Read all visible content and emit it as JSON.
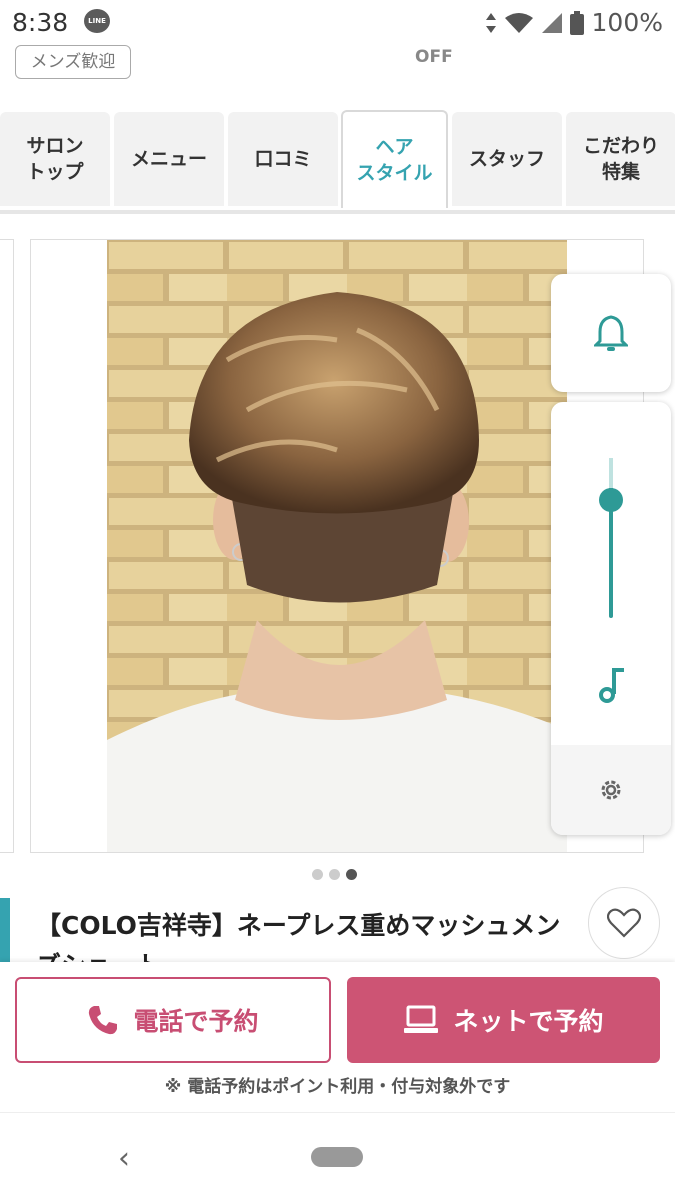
{
  "status_bar": {
    "time": "8:38",
    "line_badge": "LINE",
    "battery": "100%"
  },
  "top_strip": {
    "mens_tag": "メンズ歓迎",
    "off_label": "OFF"
  },
  "tabs": [
    {
      "label": "サロン\nトップ",
      "active": false
    },
    {
      "label": "メニュー",
      "active": false
    },
    {
      "label": "口コミ",
      "active": false
    },
    {
      "label": "ヘア\nスタイル",
      "active": true
    },
    {
      "label": "スタッフ",
      "active": false
    },
    {
      "label": "こだわり\n特集",
      "active": false
    }
  ],
  "carousel": {
    "current_index": 3,
    "total": 3
  },
  "style": {
    "title": "【COLO吉祥寺】ネープレス重めマッシュメンズショート"
  },
  "media_panel": {
    "volume_level": 0.82
  },
  "booking": {
    "phone_label": "電話で予約",
    "net_label": "ネットで予約",
    "note": "※ 電話予約はポイント利用・付与対象外です"
  },
  "colors": {
    "accent": "#35a3b0",
    "booking": "#cd5474",
    "panel": "#2e9a96"
  }
}
